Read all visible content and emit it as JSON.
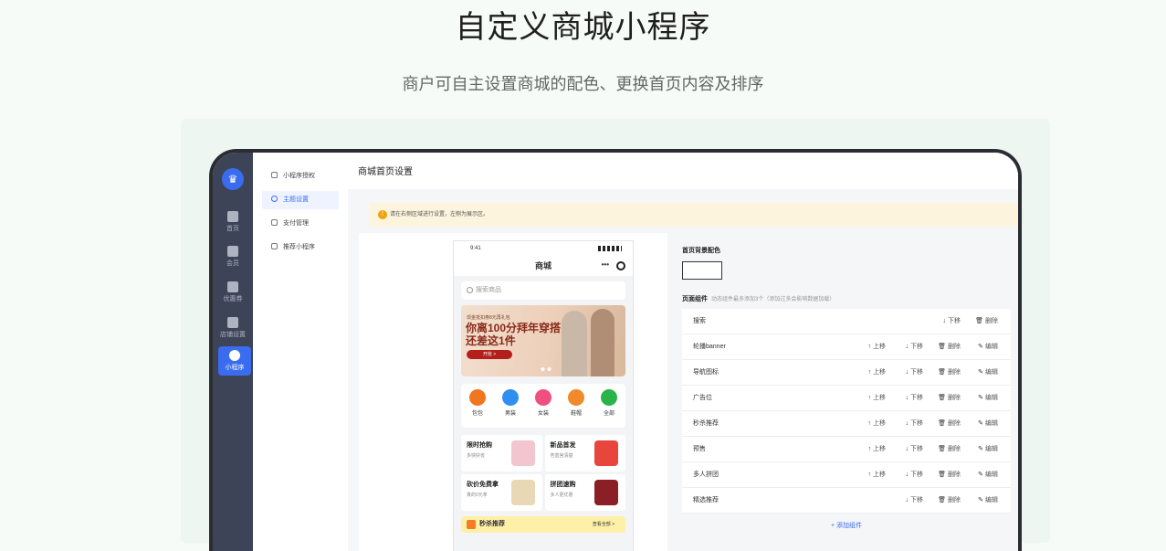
{
  "hero": {
    "title": "自定义商城小程序",
    "subtitle": "商户可自主设置商城的配色、更换首页内容及排序"
  },
  "nav_primary": [
    {
      "label": "首页",
      "icon": "home-icon"
    },
    {
      "label": "会员",
      "icon": "member-icon"
    },
    {
      "label": "优惠券",
      "icon": "coupon-icon"
    },
    {
      "label": "店铺设置",
      "icon": "store-settings-icon"
    },
    {
      "label": "小程序",
      "icon": "miniprogram-icon",
      "active": true
    }
  ],
  "nav_secondary": [
    {
      "label": "小程序授权"
    },
    {
      "label": "主题设置",
      "active": true
    },
    {
      "label": "支付管理"
    },
    {
      "label": "推荐小程序"
    }
  ],
  "page": {
    "title": "商城首页设置",
    "tip": "请在右侧区域进行设置，左侧为展示区。"
  },
  "phone": {
    "time": "9:41",
    "title": "商城",
    "search_placeholder": "搜索商品",
    "banner": {
      "small_text": "现金抵扣券8元再礼包",
      "headline1": "你离100分拜年穿搭",
      "headline2": "还差这1件",
      "button": "开抢 >"
    },
    "icons": [
      {
        "label": "包包",
        "color": "#f0761f"
      },
      {
        "label": "男装",
        "color": "#2e8ff0"
      },
      {
        "label": "女装",
        "color": "#f0507f"
      },
      {
        "label": "鞋帽",
        "color": "#f08a2a"
      },
      {
        "label": "全部",
        "color": "#2bb34a"
      }
    ],
    "cells": [
      {
        "title": "限时抢购",
        "sub": "多快好省",
        "color": "#f3c6cf"
      },
      {
        "title": "新品首发",
        "sub": "杏蓝宫清楚",
        "color": "#e8453c"
      },
      {
        "title": "砍价免费拿",
        "sub": "真的0元拿",
        "color": "#ead7b6"
      },
      {
        "title": "拼团速购",
        "sub": "多人更优惠",
        "color": "#8a1f26"
      }
    ],
    "flash_title": "秒杀推荐",
    "flash_more": "查看全部 >"
  },
  "config": {
    "bg_label": "首页背景配色",
    "bg_color": "#ffffff",
    "components_label": "页面组件",
    "components_hint": "动态组件最多添加3个（添加过多会影响数据加载）",
    "action_labels": {
      "up": "上移",
      "down": "下移",
      "delete": "删除",
      "edit": "编辑"
    },
    "components": [
      {
        "name": "搜索"
      },
      {
        "name": "轮播banner"
      },
      {
        "name": "导航图标"
      },
      {
        "name": "广告位"
      },
      {
        "name": "秒杀推荐"
      },
      {
        "name": "预售"
      },
      {
        "name": "多人拼团"
      },
      {
        "name": "精选推荐"
      }
    ],
    "add_label": "+ 添加组件"
  }
}
